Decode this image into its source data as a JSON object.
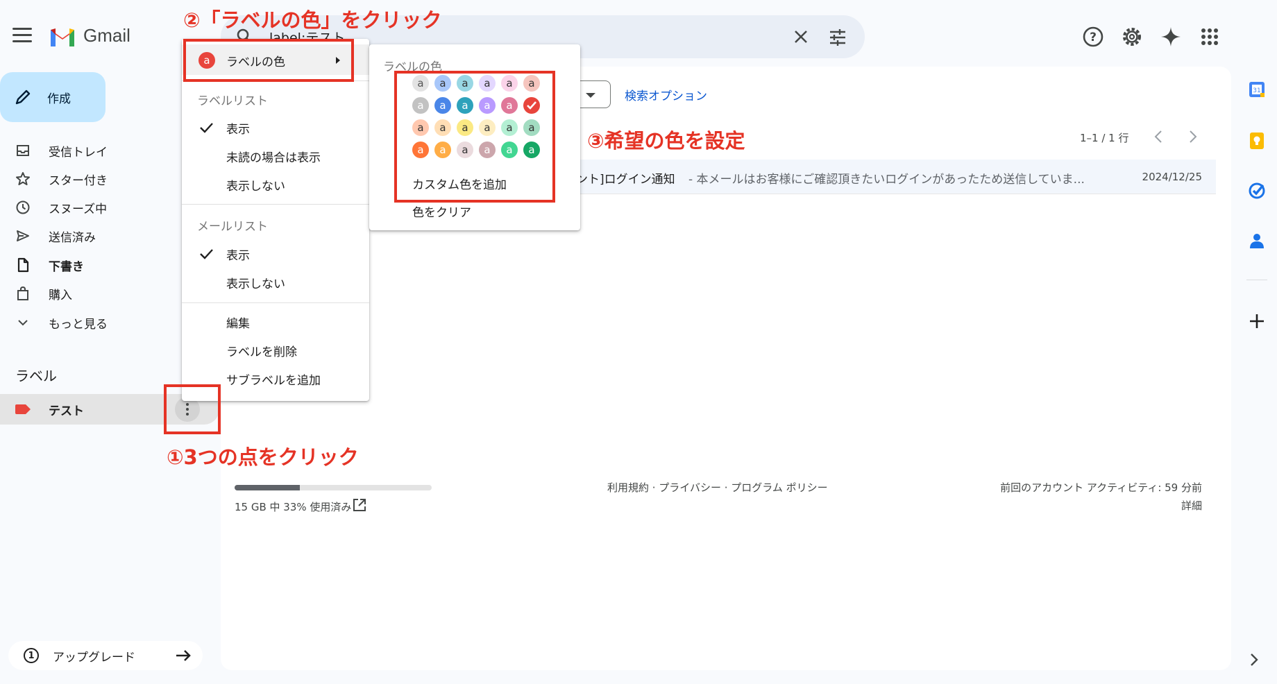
{
  "app": {
    "name": "Gmail"
  },
  "search": {
    "query": "label:テスト"
  },
  "compose": {
    "label": "作成"
  },
  "nav": [
    {
      "label": "受信トレイ",
      "icon": "inbox-icon",
      "bold": false
    },
    {
      "label": "スター付き",
      "icon": "star-icon",
      "bold": false
    },
    {
      "label": "スヌーズ中",
      "icon": "clock-icon",
      "bold": false
    },
    {
      "label": "送信済み",
      "icon": "send-icon",
      "bold": false
    },
    {
      "label": "下書き",
      "icon": "draft-icon",
      "bold": true
    },
    {
      "label": "購入",
      "icon": "purchase-bag-icon",
      "bold": false
    },
    {
      "label": "もっと見る",
      "icon": "chevron-down-icon",
      "bold": false
    }
  ],
  "labels": {
    "heading": "ラベル",
    "items": [
      {
        "name": "テスト",
        "color": "#e8453c"
      }
    ]
  },
  "upgrade": {
    "number": "1",
    "label": "アップグレード"
  },
  "main": {
    "search_options": "検索オプション",
    "pager": "1–1 / 1 行",
    "mail": {
      "subject": "ント]ログイン通知",
      "snippet": " - 本メールはお客様にご確認頂きたいログインがあったため送信していま...",
      "date": "2024/12/25"
    },
    "storage": {
      "text": "15 GB 中 33% 使用済み",
      "percent": 33
    },
    "footer_links": "利用規約 · プライバシー · プログラム ポリシー",
    "last_activity": "前回のアカウント アクティビティ: 59 分前",
    "details": "詳細"
  },
  "label_menu": {
    "color_item": {
      "label": "ラベルの色",
      "letter": "a",
      "color": "#e8453c"
    },
    "sections": [
      {
        "heading": "ラベルリスト",
        "items": [
          {
            "label": "表示",
            "checked": true
          },
          {
            "label": "未読の場合は表示",
            "checked": false
          },
          {
            "label": "表示しない",
            "checked": false
          }
        ]
      },
      {
        "heading": "メールリスト",
        "items": [
          {
            "label": "表示",
            "checked": true
          },
          {
            "label": "表示しない",
            "checked": false
          }
        ]
      }
    ],
    "actions": [
      "編集",
      "ラベルを削除",
      "サブラベルを追加"
    ]
  },
  "color_menu": {
    "heading": "ラベルの色",
    "letter": "a",
    "swatches": [
      [
        {
          "bg": "#e3e3e3",
          "fg": "#555"
        },
        {
          "bg": "#a8c7fa",
          "fg": "#333"
        },
        {
          "bg": "#98d7e4",
          "fg": "#333"
        },
        {
          "bg": "#e3d7ff",
          "fg": "#333"
        },
        {
          "bg": "#fbd3e9",
          "fg": "#333"
        },
        {
          "bg": "#f6c5be",
          "fg": "#333"
        }
      ],
      [
        {
          "bg": "#c2c2c2",
          "fg": "#fff"
        },
        {
          "bg": "#4a86e8",
          "fg": "#fff"
        },
        {
          "bg": "#2da2bb",
          "fg": "#fff"
        },
        {
          "bg": "#b99aff",
          "fg": "#fff"
        },
        {
          "bg": "#e07798",
          "fg": "#fff"
        },
        {
          "bg": "#e8453c",
          "fg": "#fff",
          "selected": true
        }
      ],
      [
        {
          "bg": "#ffc8af",
          "fg": "#333"
        },
        {
          "bg": "#ffdeb5",
          "fg": "#333"
        },
        {
          "bg": "#fbe983",
          "fg": "#333"
        },
        {
          "bg": "#fdedc1",
          "fg": "#333"
        },
        {
          "bg": "#b3efd3",
          "fg": "#333"
        },
        {
          "bg": "#a2dcc1",
          "fg": "#333"
        }
      ],
      [
        {
          "bg": "#ff7537",
          "fg": "#fff"
        },
        {
          "bg": "#ffad46",
          "fg": "#fff"
        },
        {
          "bg": "#ebdbde",
          "fg": "#333"
        },
        {
          "bg": "#cca6ac",
          "fg": "#fff"
        },
        {
          "bg": "#42d692",
          "fg": "#fff"
        },
        {
          "bg": "#16a765",
          "fg": "#fff"
        }
      ]
    ],
    "custom": "カスタム色を追加",
    "clear": "色をクリア"
  },
  "annotations": {
    "step1": "①3つの点をクリック",
    "step2": "②「ラベルの色」をクリック",
    "step3": "③希望の色を設定"
  },
  "colors": {
    "accent": "#e53325",
    "compose_bg": "#c2e7ff",
    "link": "#0b57d0"
  }
}
